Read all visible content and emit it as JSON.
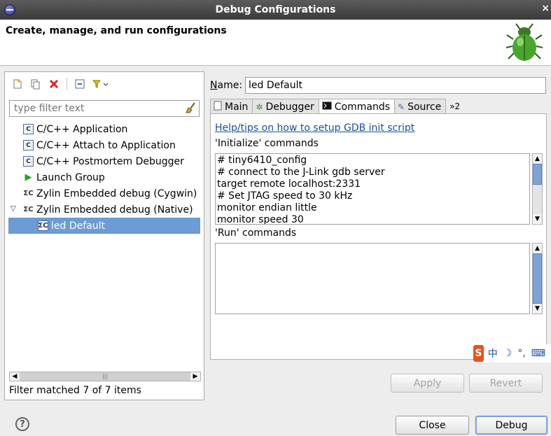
{
  "window": {
    "title": "Debug Configurations",
    "subtitle": "Create, manage, and run configurations"
  },
  "left": {
    "filter_placeholder": "type filter text",
    "tree": [
      {
        "label": "C/C++ Application",
        "icon": "c-app-icon",
        "level": 1
      },
      {
        "label": "C/C++ Attach to Application",
        "icon": "c-attach-icon",
        "level": 1
      },
      {
        "label": "C/C++ Postmortem Debugger",
        "icon": "c-postmortem-icon",
        "level": 1
      },
      {
        "label": "Launch Group",
        "icon": "launch-group-icon",
        "level": 1
      },
      {
        "label": "Zylin Embedded debug (Cygwin)",
        "icon": "zylin-icon",
        "level": 1
      },
      {
        "label": "Zylin Embedded debug (Native)",
        "icon": "zylin-icon",
        "level": 1,
        "expanded": true
      },
      {
        "label": "led Default",
        "icon": "zylin-config-icon",
        "level": 2,
        "selected": true
      }
    ],
    "filter_status": "Filter matched 7 of 7 items"
  },
  "right": {
    "name_label": "Name:",
    "name_underline": "N",
    "name_rest": "ame:",
    "name_value": "led Default",
    "tabs": [
      {
        "label": "Main",
        "icon": "main-tab-icon"
      },
      {
        "label": "Debugger",
        "icon": "debugger-tab-icon"
      },
      {
        "label": "Commands",
        "icon": "commands-tab-icon",
        "active": true
      },
      {
        "label": "Source",
        "icon": "source-tab-icon"
      }
    ],
    "tabs_overflow": "»2",
    "help_link": "Help/tips on how to setup GDB init script",
    "init_label": "'Initialize' commands",
    "init_lines": [
      "# tiny6410_config",
      "# connect to the J-Link gdb server",
      "target remote localhost:2331",
      "# Set JTAG speed to 30 kHz",
      "monitor endian little",
      "monitor speed 30"
    ],
    "run_label": "'Run' commands",
    "run_value": ""
  },
  "buttons": {
    "apply": "Apply",
    "revert": "Revert",
    "close": "Close",
    "debug": "Debug"
  },
  "ime": {
    "logo": "S",
    "chars": [
      "中",
      "☽",
      "°,",
      "⌨"
    ]
  },
  "colors": {
    "selection": "#6c9bd6",
    "link": "#1b4fa0",
    "titlebar": "#444444"
  }
}
